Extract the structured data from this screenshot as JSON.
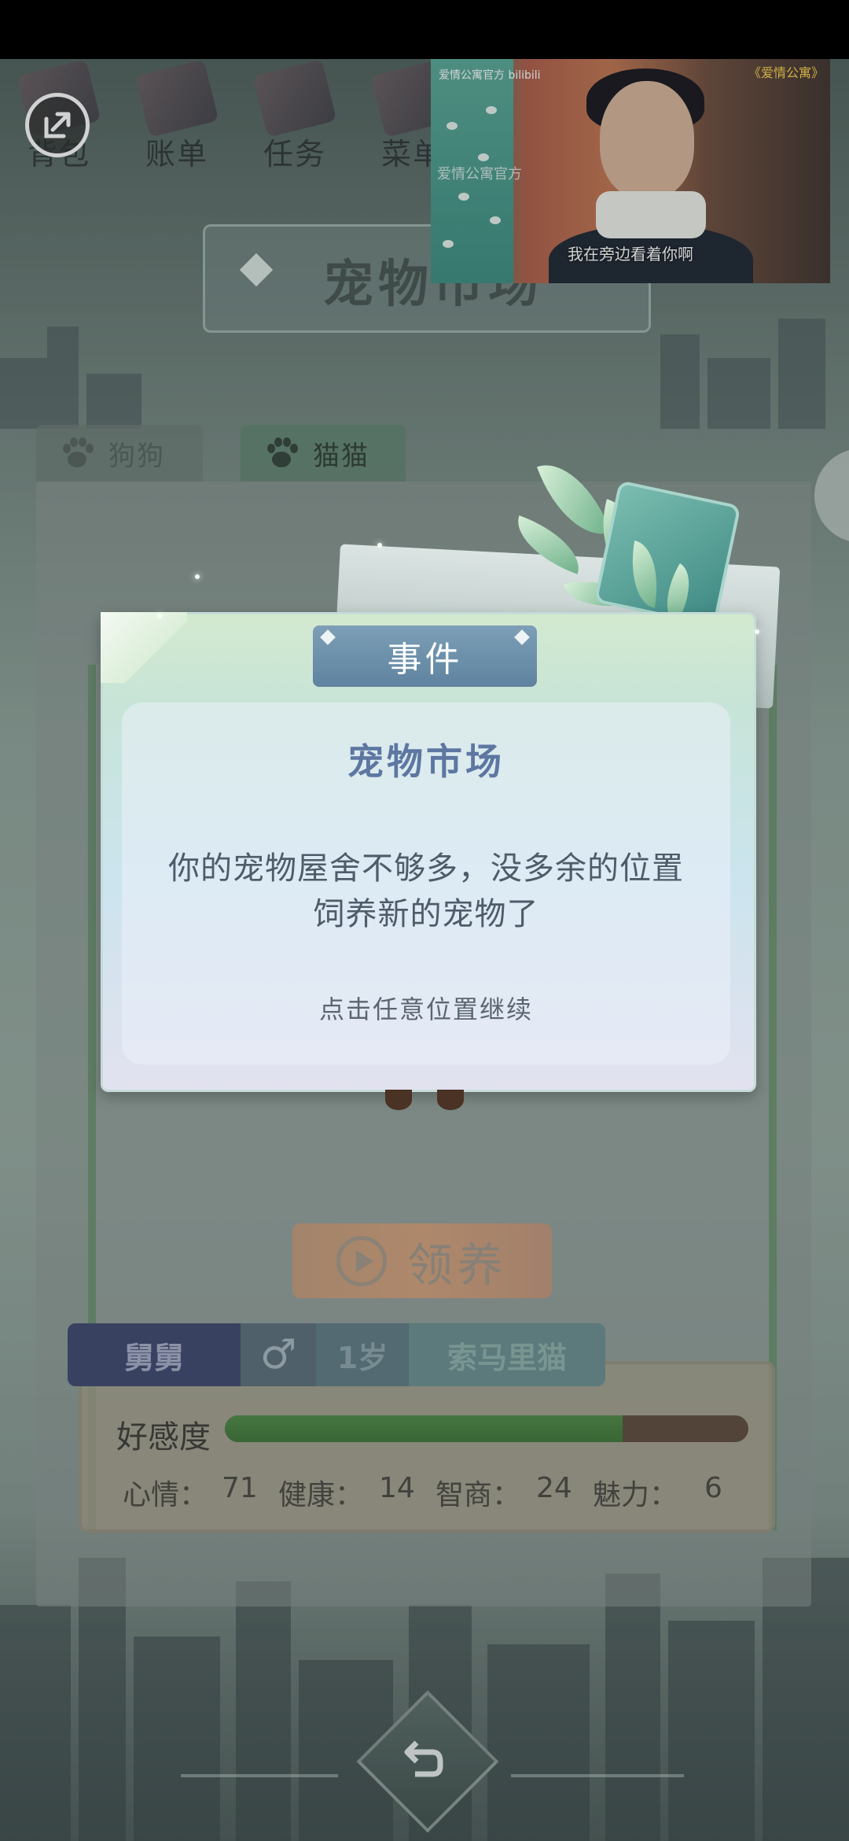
{
  "top_menu": {
    "items": [
      {
        "label": "背包",
        "icon": "bag-icon"
      },
      {
        "label": "账单",
        "icon": "bill-icon"
      },
      {
        "label": "任务",
        "icon": "task-icon"
      },
      {
        "label": "菜单",
        "icon": "menu-icon"
      }
    ]
  },
  "banner": {
    "title": "宠物市场"
  },
  "video": {
    "watermark_left": "爱情公寓官方",
    "platform": "bilibili",
    "watermark_mid": "爱情公寓官方",
    "title_right": "《爱情公寓》",
    "subtitle": "我在旁边看着你啊"
  },
  "tabs": [
    {
      "label": "狗狗",
      "selected": false
    },
    {
      "label": "猫猫",
      "selected": true
    }
  ],
  "adopt_button": {
    "label": "领养"
  },
  "pet": {
    "name": "舅舅",
    "sex_symbol": "♂",
    "age": "1岁",
    "breed": "索马里猫",
    "favor_label": "好感度",
    "favor_fraction": 0.76,
    "stats": [
      {
        "label": "心情：",
        "value": "71"
      },
      {
        "label": "健康：",
        "value": "14"
      },
      {
        "label": "智商：",
        "value": "24"
      },
      {
        "label": "魅力：",
        "value": "6"
      }
    ]
  },
  "modal": {
    "tab_label": "事件",
    "title": "宠物市场",
    "message": "你的宠物屋舍不够多，没多余的位置饲养新的宠物了",
    "hint": "点击任意位置继续"
  },
  "colors": {
    "accent_title": "#5d77a2",
    "favor_fill": "#4f8a45",
    "name_bg": "#3e466f"
  }
}
